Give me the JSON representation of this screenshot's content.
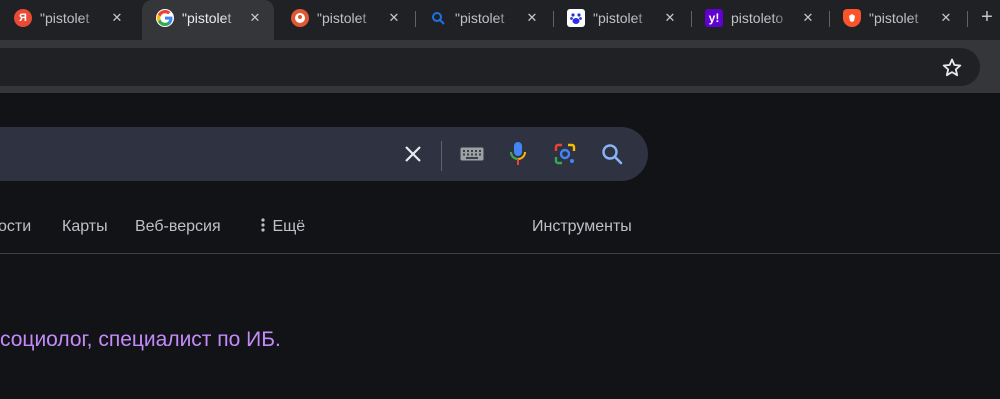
{
  "tabs": [
    {
      "title": "\"pistolet",
      "favicon": "yandex-icon",
      "active": false
    },
    {
      "title": "\"pistolet",
      "favicon": "google-icon",
      "active": true
    },
    {
      "title": "\"pistolet",
      "favicon": "duckduckgo-icon",
      "active": false
    },
    {
      "title": "\"pistolet",
      "favicon": "search-icon",
      "active": false
    },
    {
      "title": "\"pistolet",
      "favicon": "baidu-icon",
      "active": false
    },
    {
      "title": "pistoleto",
      "favicon": "yahoo-icon",
      "active": false
    },
    {
      "title": "\"pistolet",
      "favicon": "brave-icon",
      "active": false
    }
  ],
  "search": {
    "clear_icon": "close-icon",
    "keyboard_icon": "keyboard-icon",
    "voice_icon": "mic-icon",
    "lens_icon": "lens-icon",
    "submit_icon": "search-icon"
  },
  "nav": {
    "news_partial": "ости",
    "maps": "Карты",
    "web": "Веб-версия",
    "more": "Ещё",
    "tools": "Инструменты"
  },
  "result": {
    "snippet_partial": "социолог, специалист по ИБ."
  },
  "colors": {
    "page_bg": "#121317",
    "tab_strip": "#202124",
    "toolbar": "#35363a",
    "searchbox": "#2f3240",
    "link_visited": "#c58af9"
  }
}
